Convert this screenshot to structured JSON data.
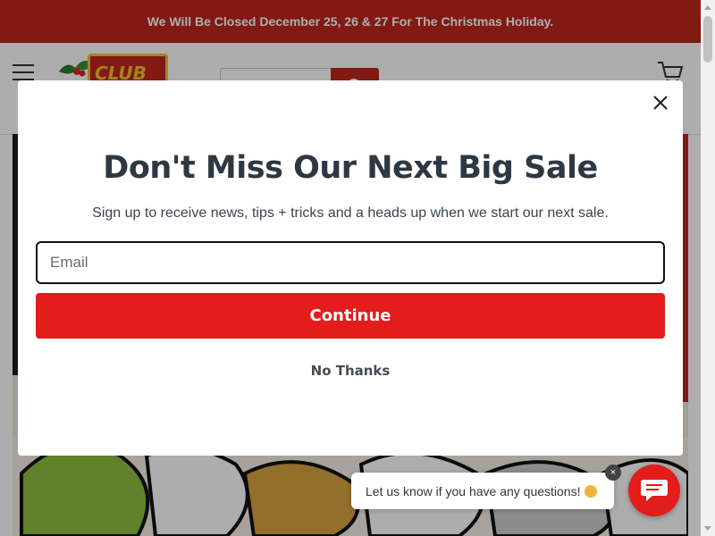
{
  "announcement": {
    "text": "We Will Be Closed December 25, 26 & 27 For The Christmas Holiday."
  },
  "header": {
    "logo_text": "CLUB",
    "menu_icon": "hamburger-menu-icon",
    "search_icon": "search-icon",
    "cart_icon": "cart-icon"
  },
  "modal": {
    "title": "Don't Miss Our Next Big Sale",
    "subtitle": "Sign up to receive news, tips + tricks and a heads up when we start our next sale.",
    "email_placeholder": "Email",
    "continue_label": "Continue",
    "no_thanks_label": "No Thanks",
    "close_icon": "close-icon"
  },
  "chat": {
    "prompt_text": "Let us know if you have any questions!",
    "emoji_icon": "smiling-face-icon",
    "dismiss_label": "×",
    "launcher_icon": "chat-icon"
  },
  "colors": {
    "brand_red": "#c0261c",
    "button_red": "#e31c1c",
    "title_text": "#2e3842"
  }
}
